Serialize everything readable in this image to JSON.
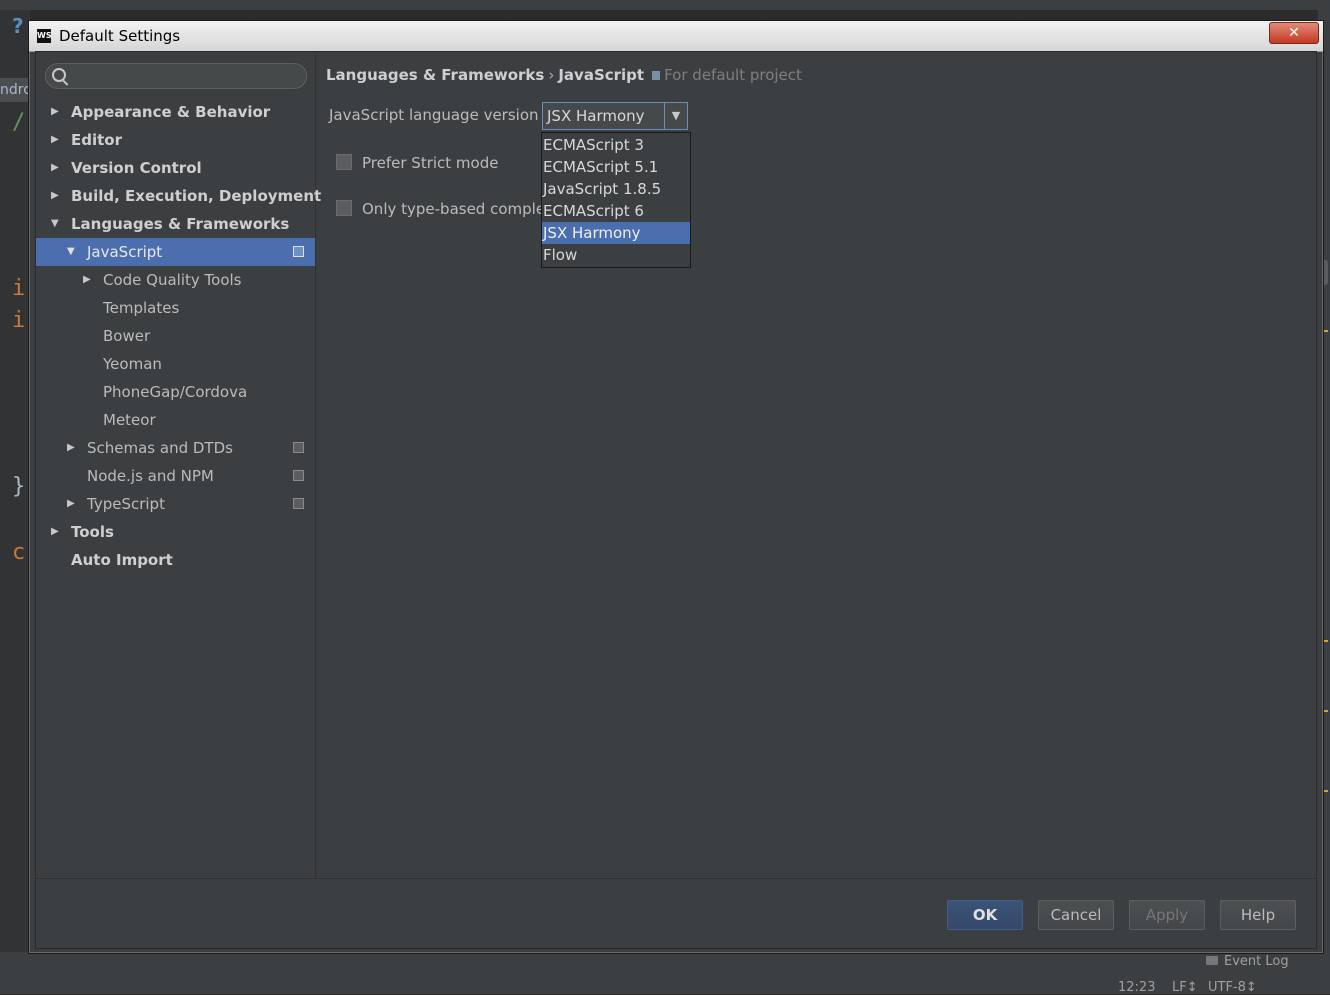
{
  "ide": {
    "help_glyph": "?",
    "tab_text": "ndro",
    "code_chars": [
      "/",
      "i",
      "i",
      "}",
      "c"
    ],
    "statusbar": {
      "event_log": "Event Log",
      "position": "12:23",
      "line_sep": "LF↕",
      "encoding": "UTF-8↕"
    },
    "colors": {
      "accent_orange": "#cc7832",
      "selection_blue": "#4b6eaf"
    }
  },
  "dialog": {
    "app_icon": "WS",
    "title": "Default Settings",
    "close_glyph": "✕"
  },
  "tree": {
    "items": [
      {
        "label": "Appearance & Behavior",
        "arrow": "▶"
      },
      {
        "label": "Editor",
        "arrow": "▶"
      },
      {
        "label": "Version Control",
        "arrow": "▶"
      },
      {
        "label": "Build, Execution, Deployment",
        "arrow": "▶"
      },
      {
        "label": "Languages & Frameworks",
        "arrow": "▼"
      },
      {
        "label": "JavaScript",
        "arrow": "▼"
      },
      {
        "label": "Code Quality Tools",
        "arrow": "▶"
      },
      {
        "label": "Templates"
      },
      {
        "label": "Bower"
      },
      {
        "label": "Yeoman"
      },
      {
        "label": "PhoneGap/Cordova"
      },
      {
        "label": "Meteor"
      },
      {
        "label": "Schemas and DTDs",
        "arrow": "▶"
      },
      {
        "label": "Node.js and NPM"
      },
      {
        "label": "TypeScript",
        "arrow": "▶"
      },
      {
        "label": "Tools",
        "arrow": "▶"
      },
      {
        "label": "Auto Import"
      }
    ]
  },
  "breadcrumb": {
    "parent": "Languages & Frameworks",
    "separator": "›",
    "current": "JavaScript",
    "scope": "For default project"
  },
  "form": {
    "language_version_label": "JavaScript language version",
    "language_version_value": "JSX Harmony",
    "combo_arrow": "▼",
    "strict_mode_label": "Prefer Strict mode",
    "type_based_label": "Only type-based comple",
    "options": [
      "ECMAScript 3",
      "ECMAScript 5.1",
      "JavaScript 1.8.5",
      "ECMAScript 6",
      "JSX Harmony",
      "Flow"
    ],
    "selected_option": "JSX Harmony"
  },
  "buttons": {
    "ok": "OK",
    "cancel": "Cancel",
    "apply": "Apply",
    "help": "Help"
  }
}
